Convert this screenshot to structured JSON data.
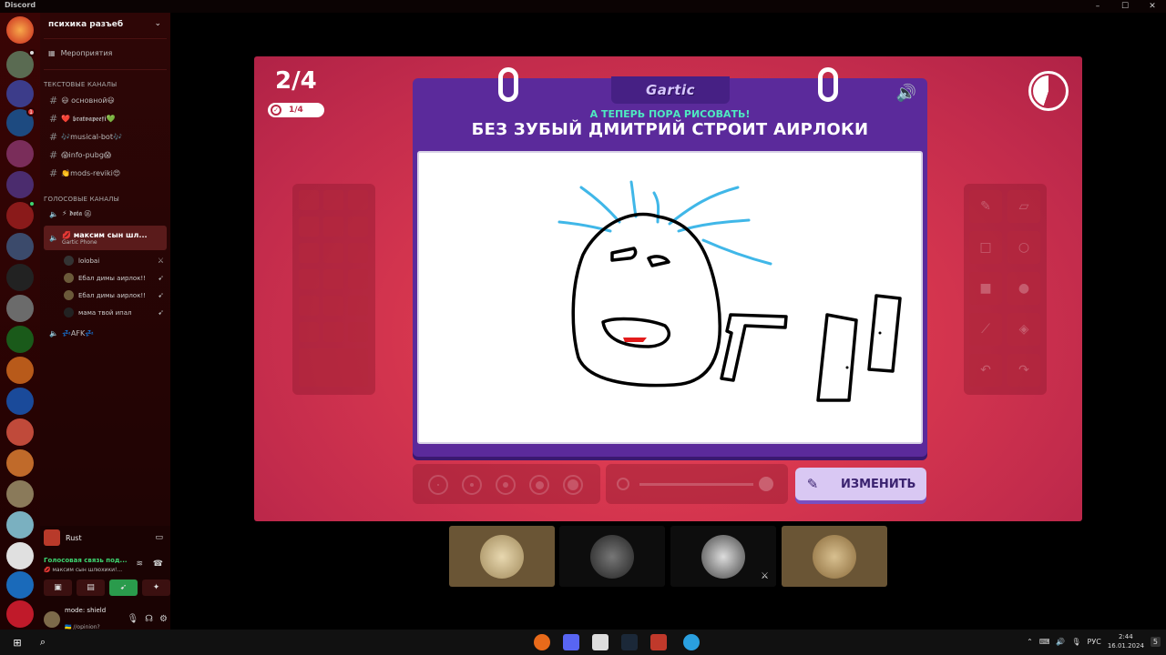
{
  "window": {
    "title": "Discord",
    "min": "–",
    "max": "☐",
    "close": "✕"
  },
  "server": {
    "name": "психика разъеб",
    "events_label": "Мероприятия"
  },
  "categories": {
    "text": "ТЕКСТОВЫЕ КАНАЛЫ",
    "voice": "ГОЛОСОВЫЕ КАНАЛЫ"
  },
  "text_channels": [
    "😃 основной😃",
    "❤️ 𝖇𝖗𝖆𝖙𝖛𝖆𝖕𝖊𝖊𝖋𝖎💚",
    "🎶musical-bot🎶",
    "😱info-pubg😱",
    "👏mods-reviki😍"
  ],
  "voice_channels": {
    "dota": "⚡ 𝖉𝖔𝖙𝖆 ⑯",
    "active": "💋 максим сын шл...",
    "active_sub": "Gartic Phone",
    "afk": "💤AFK💤"
  },
  "members": [
    "lolobai",
    "Ебал димы аирлок!!",
    "Ебал димы аирлок!!",
    "мама твой ипал"
  ],
  "server_badges": {
    "b1": "1"
  },
  "activity": {
    "game": "Rust"
  },
  "voice": {
    "status": "Голосовая связь под...",
    "channel": "💋 максим сын шлюхики!..."
  },
  "user": {
    "name": "mode: shield",
    "status": "🇺🇦 //opinion?"
  },
  "game": {
    "round": "2/4",
    "done": "1/4",
    "logo": "Gartic",
    "prompt_small": "А ТЕПЕРЬ ПОРА РИСОВАТЬ!",
    "prompt_big": "БЕЗ ЗУБЫЙ ДМИТРИЙ СТРОИТ АИРЛОКИ",
    "edit_label": "ИЗМЕНИТЬ"
  },
  "taskbar": {
    "lang": "РУС",
    "time": "2:44",
    "date": "16.01.2024",
    "notif": "5"
  },
  "icons": {
    "search": "search-icon",
    "speaker": "speaker-icon",
    "timer": "timer-icon",
    "pencil": "pencil-icon"
  },
  "colors": {
    "accent_red": "#d8374f",
    "board_purple": "#5b2a9b",
    "prompt_teal": "#4eeac0"
  }
}
